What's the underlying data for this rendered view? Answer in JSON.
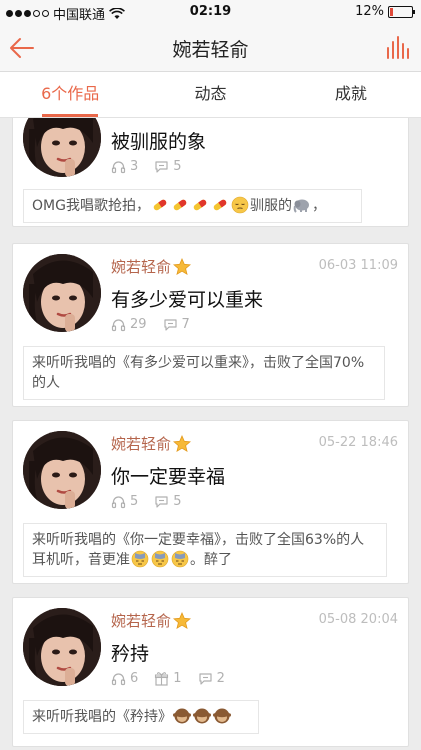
{
  "status": {
    "carrier": "中国联通",
    "time": "02:19",
    "battery": "12%",
    "battery_level": 0.12
  },
  "nav": {
    "title": "婉若轻俞",
    "back_icon": "back-arrow-icon",
    "right_icon": "bar-chart-icon",
    "accent": "#e9684a"
  },
  "tabs": [
    {
      "label": "6个作品",
      "active": true
    },
    {
      "label": "动态",
      "active": false
    },
    {
      "label": "成就",
      "active": false
    }
  ],
  "posts": [
    {
      "song": "被驯服的象",
      "listens": "3",
      "comments": "5",
      "comment_text_prefix": "OMG我唱歌抢拍，",
      "comment_text_suffix": "驯服的",
      "comment_tail": "，"
    },
    {
      "author": "婉若轻俞",
      "date": "06-03 11:09",
      "song": "有多少爱可以重来",
      "listens": "29",
      "comments": "7",
      "comment_text": "来听听我唱的《有多少爱可以重来》，击败了全国70%的人"
    },
    {
      "author": "婉若轻俞",
      "date": "05-22 18:46",
      "song": "你一定要幸福",
      "listens": "5",
      "comments": "5",
      "comment_text_prefix": "来听听我唱的《你一定要幸福》，击败了全国63%的人耳机听，音更准",
      "comment_text_suffix": "。醉了"
    },
    {
      "author": "婉若轻俞",
      "date": "05-08 20:04",
      "song": "矜持",
      "listens": "6",
      "gifts": "1",
      "comments": "2",
      "comment_text": "来听听我唱的《矜持》"
    }
  ]
}
